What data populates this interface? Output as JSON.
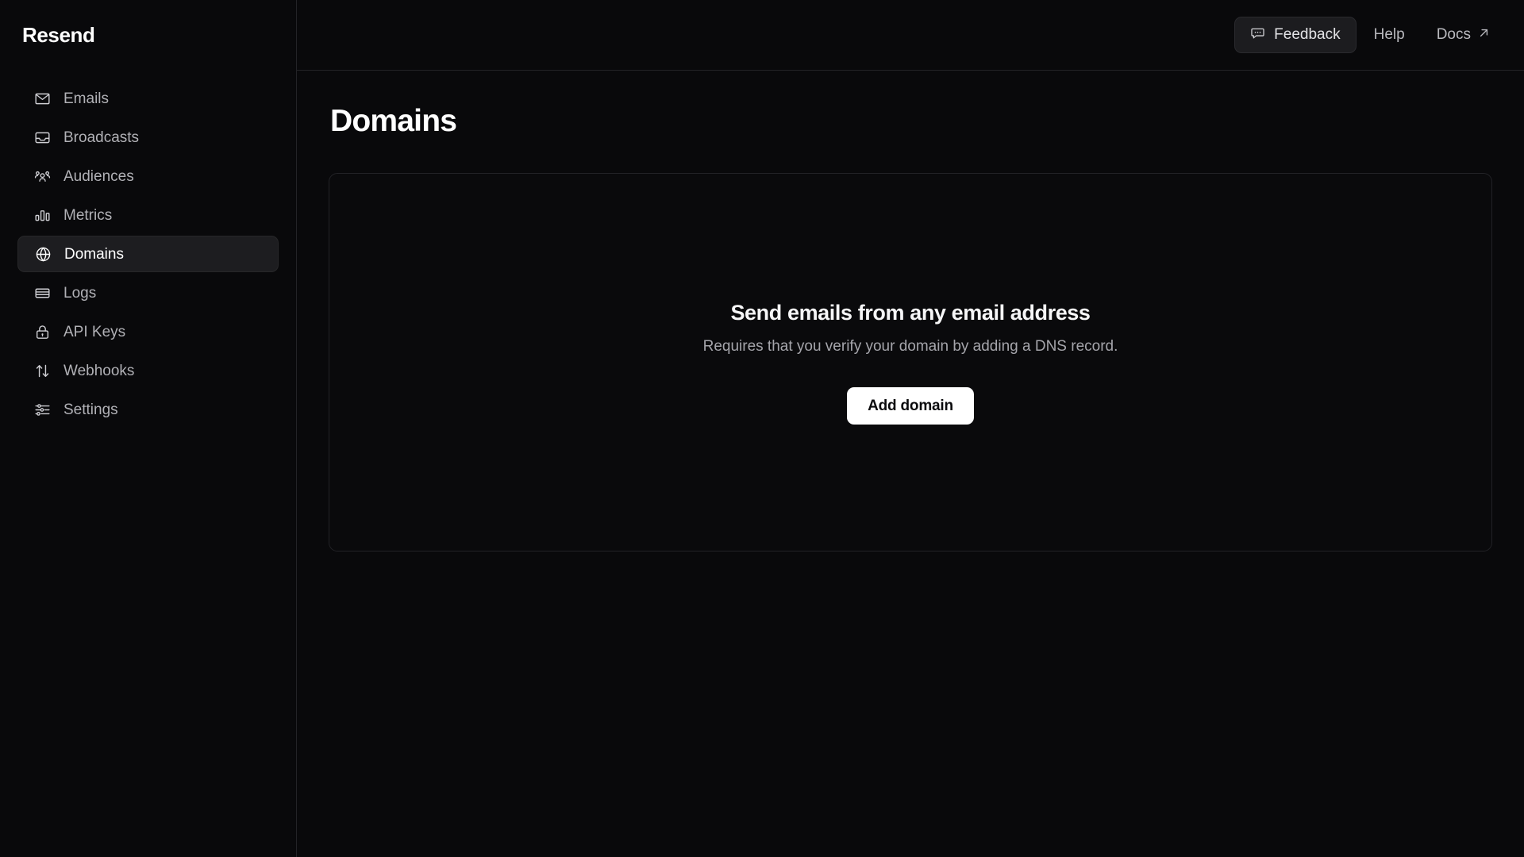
{
  "brand": {
    "name": "Resend"
  },
  "sidebar": {
    "items": [
      {
        "label": "Emails",
        "icon": "envelope-icon",
        "active": false
      },
      {
        "label": "Broadcasts",
        "icon": "inbox-icon",
        "active": false
      },
      {
        "label": "Audiences",
        "icon": "users-icon",
        "active": false
      },
      {
        "label": "Metrics",
        "icon": "bar-chart-icon",
        "active": false
      },
      {
        "label": "Domains",
        "icon": "globe-icon",
        "active": true
      },
      {
        "label": "Logs",
        "icon": "rows-icon",
        "active": false
      },
      {
        "label": "API Keys",
        "icon": "lock-icon",
        "active": false
      },
      {
        "label": "Webhooks",
        "icon": "arrows-updown-icon",
        "active": false
      },
      {
        "label": "Settings",
        "icon": "sliders-icon",
        "active": false
      }
    ]
  },
  "topbar": {
    "feedback_label": "Feedback",
    "feedback_icon": "message-dots-icon",
    "help_label": "Help",
    "docs_label": "Docs",
    "docs_icon": "arrow-up-right-icon"
  },
  "main": {
    "page_title": "Domains",
    "empty_state": {
      "title": "Send emails from any email address",
      "subtitle": "Requires that you verify your domain by adding a DNS record.",
      "action_label": "Add domain"
    }
  },
  "colors": {
    "background": "#09090b",
    "border": "#232327",
    "active_item_bg": "#1d1d20",
    "text_primary": "#ffffff",
    "text_muted": "#b1b1b6",
    "accent_button_bg": "#ffffff",
    "accent_button_text": "#0b0b0d"
  }
}
